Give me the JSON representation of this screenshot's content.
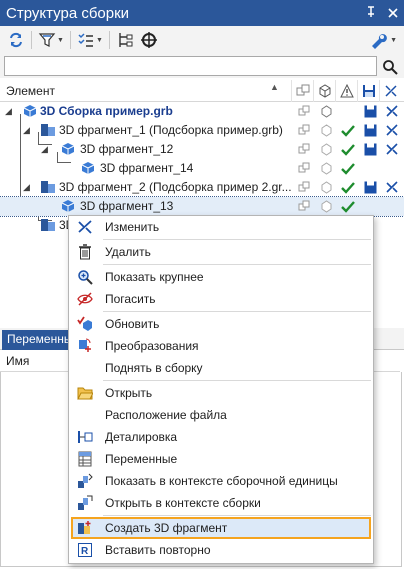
{
  "window": {
    "title": "Структура сборки",
    "pin_glyph": "⊥",
    "close_glyph": "✕"
  },
  "search": {
    "value": "",
    "placeholder": ""
  },
  "tree": {
    "column_header": "Элемент",
    "rows": [
      {
        "label": "3D Сборка пример.grb",
        "bold": true
      },
      {
        "label": "3D фрагмент_1 (Подсборка пример.grb)"
      },
      {
        "label": "3D фрагмент_12"
      },
      {
        "label": "3D фрагмент_14"
      },
      {
        "label": "3D фрагмент_2 (Подсборка пример 2.gr..."
      },
      {
        "label": "3D фрагмент_13"
      },
      {
        "label": "3D"
      }
    ]
  },
  "lower_panel": {
    "tab_active": "Переменные",
    "tab_other": "ты",
    "name_column": "Имя"
  },
  "context_menu": {
    "items": [
      "Изменить",
      "Удалить",
      "Показать крупнее",
      "Погасить",
      "Обновить",
      "Преобразования",
      "Поднять в сборку",
      "Открыть",
      "Расположение файла",
      "Деталировка",
      "Переменные",
      "Показать в контексте сборочной единицы",
      "Открыть в контексте сборки",
      "Создать 3D фрагмент",
      "Вставить повторно"
    ],
    "highlighted": "Создать 3D фрагмент"
  },
  "colors": {
    "accent": "#2b579a",
    "check": "#1e8c2e",
    "highlight_border": "#f5a41f",
    "highlight_bg": "#dce9f8"
  }
}
